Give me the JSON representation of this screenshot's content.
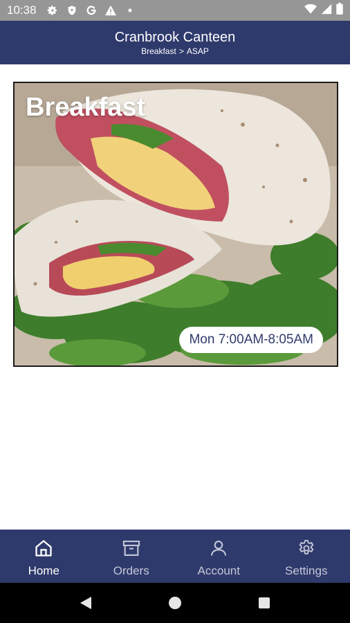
{
  "status_bar": {
    "time": "10:38",
    "icons": [
      "settings-gear-icon",
      "shield-icon",
      "google-g-icon",
      "warning-icon",
      "dot-icon"
    ],
    "right_icons": [
      "wifi-icon",
      "cellular-signal-icon",
      "battery-icon"
    ]
  },
  "header": {
    "title": "Cranbrook Canteen",
    "breadcrumb": {
      "menu": "Breakfast",
      "separator": ">",
      "timing": "ASAP"
    },
    "background": "#2f3a6c"
  },
  "menu_card": {
    "title": "Breakfast",
    "hours": "Mon 7:00AM-8:05AM",
    "image": "breakfast-wrap-photo"
  },
  "bottom_nav": {
    "items": [
      {
        "label": "Home",
        "icon": "home-icon",
        "active": true
      },
      {
        "label": "Orders",
        "icon": "archive-box-icon",
        "active": false
      },
      {
        "label": "Account",
        "icon": "person-icon",
        "active": false
      },
      {
        "label": "Settings",
        "icon": "gear-icon",
        "active": false
      }
    ]
  },
  "system_nav": {
    "icons": [
      "back-triangle-icon",
      "home-circle-icon",
      "recents-square-icon"
    ]
  },
  "colors": {
    "primary": "#2f3a6c",
    "status_bar": "#969696",
    "hours_text": "#2f3a6c"
  }
}
